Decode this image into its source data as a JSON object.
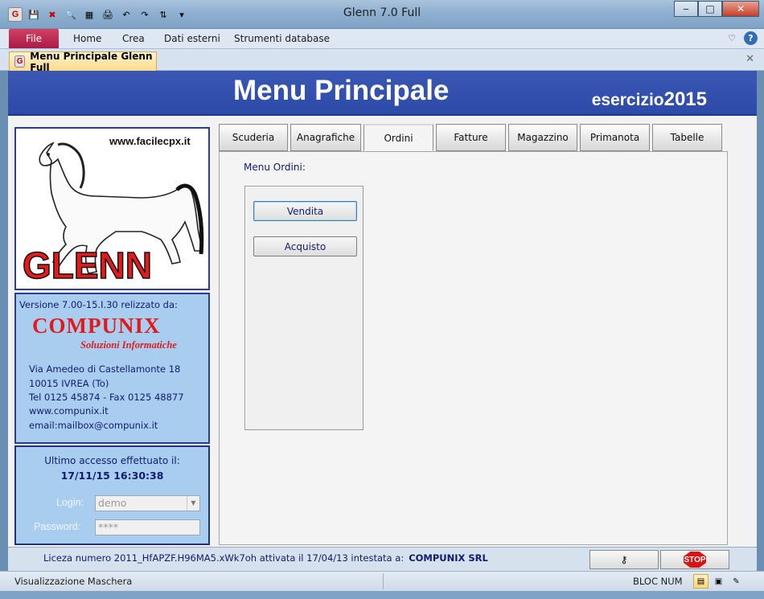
{
  "window": {
    "title": "Glenn 7.0 Full",
    "app_icon": "G",
    "minimize": "‒",
    "maximize": "□",
    "close": "✕"
  },
  "ribbon": {
    "file": "File",
    "tabs": [
      "Home",
      "Crea",
      "Dati esterni",
      "Strumenti database"
    ],
    "help": "?"
  },
  "document": {
    "tab_label": "Menu Principale Glenn Full",
    "close": "✕"
  },
  "header": {
    "title": "Menu Principale",
    "year_label": "esercizio",
    "year": "2015"
  },
  "logo": {
    "url": "www.facilecpx.it",
    "name": "GLENN"
  },
  "info": {
    "version": "Versione  7.00-15.I.30  relizzato da:",
    "company": "COMPUNIX",
    "subtitle": "Soluzioni Informatiche",
    "address": [
      "Via Amedeo di Castellamonte 18",
      "10015    IVREA    (To)",
      "Tel 0125 45874 - Fax 0125 48877",
      "www.compunix.it",
      "email:mailbox@compunix.it"
    ]
  },
  "login": {
    "last_access_label": "Ultimo accesso effettuato il:",
    "last_access": "17/11/15 16:30:38",
    "login_label": "Login:",
    "login_value": "demo",
    "password_label": "Password:",
    "password_value": "****"
  },
  "tabs": [
    "Scuderia",
    "Anagrafiche",
    "Ordini",
    "Fatture",
    "Magazzino",
    "Primanota",
    "Tabelle"
  ],
  "active_tab": "Ordini",
  "ordini": {
    "menu_label": "Menu Ordini:",
    "buttons": [
      "Vendita",
      "Acquisto"
    ]
  },
  "footer": {
    "license": "Liceza numero 2011_HfAPZF.H96MA5.xWk7oh attivata il 17/04/13 intestata a:",
    "licensee": "COMPUNIX SRL",
    "stop": "STOP"
  },
  "status": {
    "message": "Visualizzazione Maschera",
    "num_lock": "BLOC NUM"
  },
  "colors": {
    "header_blue": "#2c4aa8",
    "panel_blue": "#a9cdee",
    "brand_red": "#e11b1b",
    "text_navy": "#111a70"
  }
}
